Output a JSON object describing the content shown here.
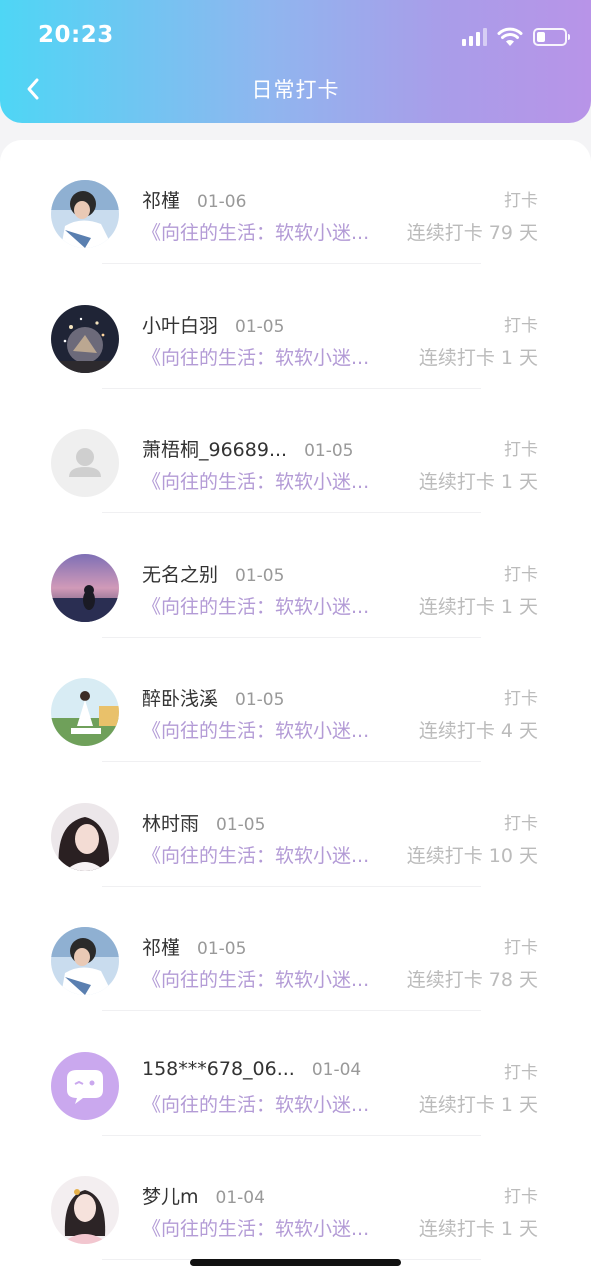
{
  "status_bar": {
    "time": "20:23",
    "battery_percent": 30
  },
  "header": {
    "title": "日常打卡",
    "back_icon": "chevron-left-icon"
  },
  "colors": {
    "gradient_start": "#4ed6f5",
    "gradient_end": "#b894e8",
    "quote": "#b39bd6"
  },
  "entries": [
    {
      "name": "祁槿",
      "date": "01-06",
      "tag": "打卡",
      "quote": "《向往的生活：软软小迷...",
      "streak": "连续打卡 79 天",
      "avatar": "portrait-boy"
    },
    {
      "name": "小叶白羽",
      "date": "01-05",
      "tag": "打卡",
      "quote": "《向往的生活：软软小迷...",
      "streak": "连续打卡 1 天",
      "avatar": "night-sky"
    },
    {
      "name": "萧梧桐_96689...",
      "date": "01-05",
      "tag": "打卡",
      "quote": "《向往的生活：软软小迷...",
      "streak": "连续打卡 1 天",
      "avatar": "default-user"
    },
    {
      "name": "无名之别",
      "date": "01-05",
      "tag": "打卡",
      "quote": "《向往的生活：软软小迷...",
      "streak": "连续打卡 1 天",
      "avatar": "sunset-girl"
    },
    {
      "name": "醉卧浅溪",
      "date": "01-05",
      "tag": "打卡",
      "quote": "《向往的生活：软软小迷...",
      "streak": "连续打卡 4 天",
      "avatar": "garden-girl"
    },
    {
      "name": "林时雨",
      "date": "01-05",
      "tag": "打卡",
      "quote": "《向往的生活：软软小迷...",
      "streak": "连续打卡 10 天",
      "avatar": "portrait-girl"
    },
    {
      "name": "祁槿",
      "date": "01-05",
      "tag": "打卡",
      "quote": "《向往的生活：软软小迷...",
      "streak": "连续打卡 78 天",
      "avatar": "portrait-boy"
    },
    {
      "name": "158***678_06...",
      "date": "01-04",
      "tag": "打卡",
      "quote": "《向往的生活：软软小迷...",
      "streak": "连续打卡 1 天",
      "avatar": "chat-bubble"
    },
    {
      "name": "梦儿m",
      "date": "01-04",
      "tag": "打卡",
      "quote": "《向往的生活：软软小迷...",
      "streak": "连续打卡 1 天",
      "avatar": "costume-girl"
    }
  ]
}
